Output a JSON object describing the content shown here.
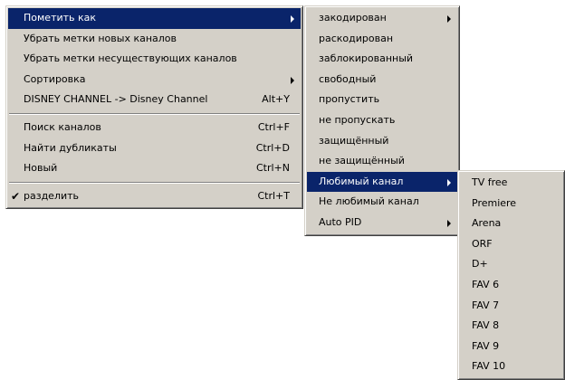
{
  "main_menu": {
    "items": [
      {
        "label": "Пометить как",
        "shortcut": "",
        "submenu": true
      },
      {
        "label": "Убрать метки новых каналов",
        "shortcut": ""
      },
      {
        "label": "Убрать метки несуществующих каналов",
        "shortcut": ""
      },
      {
        "label": "Сортировка",
        "shortcut": "",
        "submenu": true
      },
      {
        "label": "DISNEY CHANNEL -> Disney Channel",
        "shortcut": "Alt+Y"
      },
      {
        "label": "Поиск каналов",
        "shortcut": "Ctrl+F"
      },
      {
        "label": "Найти дубликаты",
        "shortcut": "Ctrl+D"
      },
      {
        "label": "Новый",
        "shortcut": "Ctrl+N"
      },
      {
        "label": "разделить",
        "shortcut": "Ctrl+T",
        "checked": true,
        "check_mark": "✔"
      }
    ]
  },
  "mark_as_submenu": {
    "items": [
      {
        "label": "закодирован",
        "submenu": true
      },
      {
        "label": "раскодирован"
      },
      {
        "label": "заблокированный"
      },
      {
        "label": "свободный"
      },
      {
        "label": "пропустить"
      },
      {
        "label": "не пропускать"
      },
      {
        "label": "защищённый"
      },
      {
        "label": "не защищённый"
      },
      {
        "label": "Любимый канал",
        "submenu": true
      },
      {
        "label": "Не любимый канал"
      },
      {
        "label": "Auto PID",
        "submenu": true
      }
    ]
  },
  "favorite_submenu": {
    "items": [
      {
        "label": "TV free"
      },
      {
        "label": "Premiere"
      },
      {
        "label": "Arena"
      },
      {
        "label": "ORF"
      },
      {
        "label": "D+"
      },
      {
        "label": "FAV 6"
      },
      {
        "label": "FAV 7"
      },
      {
        "label": "FAV 8"
      },
      {
        "label": "FAV 9"
      },
      {
        "label": "FAV 10"
      }
    ]
  },
  "colors": {
    "menu_background": "#d4d0c8",
    "highlight_background": "#0a246a",
    "highlight_text": "#ffffff"
  }
}
